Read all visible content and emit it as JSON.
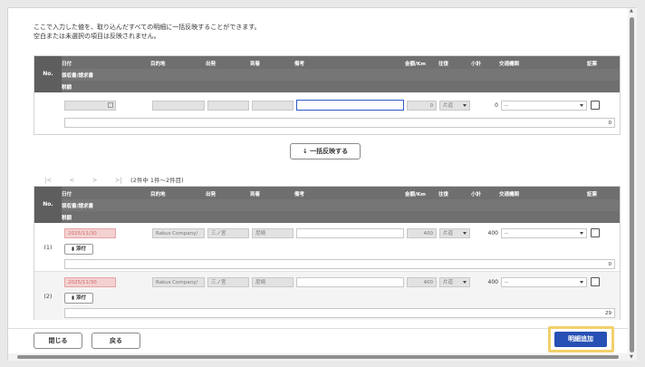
{
  "intro": {
    "line1": "ここで入力した値を、取り込んだすべての明細に一括反映することができます。",
    "line2": "空白または未選択の項目は反映されません。"
  },
  "columns": {
    "no": "No.",
    "date": "日付",
    "purpose": "目的地",
    "departure": "出発",
    "arrival": "到着",
    "notes": "備考",
    "amount": "金額/Km",
    "roundtrip": "往復",
    "subtotal": "小計",
    "transport": "交通機関",
    "receipt": "証票",
    "invoice": "領収書/請求書",
    "tax": "税額"
  },
  "bulk_row": {
    "amount": "0",
    "roundtrip": "片道",
    "subtotal": "0",
    "transport": "--",
    "tax": "0"
  },
  "bulk_button": "↓ 一括反映する",
  "pager": {
    "first": "|<",
    "prev": "<",
    "next": ">",
    "last": ">|",
    "info": "(2件中 1件〜2件目)"
  },
  "rows": [
    {
      "no": "(1)",
      "date": "2025/11/30",
      "purpose": "Rakus Company/",
      "departure": "三ノ宮",
      "arrival": "尼崎",
      "notes": "",
      "amount": "400",
      "roundtrip": "片道",
      "subtotal": "400",
      "transport": "--",
      "attach": "添付",
      "tax": "0"
    },
    {
      "no": "(2)",
      "date": "2025/11/30",
      "purpose": "Rakus Company/",
      "departure": "三ノ宮",
      "arrival": "尼崎",
      "notes": "",
      "amount": "400",
      "roundtrip": "片道",
      "subtotal": "400",
      "transport": "--",
      "attach": "添付",
      "tax": "29"
    }
  ],
  "footer": {
    "close": "閉じる",
    "back": "戻る",
    "add": "明細追加"
  },
  "colors": {
    "header": "#6f6f6f",
    "primary": "#2650b4",
    "highlight": "#f2d06b",
    "error_bg": "#f3d1d1"
  }
}
